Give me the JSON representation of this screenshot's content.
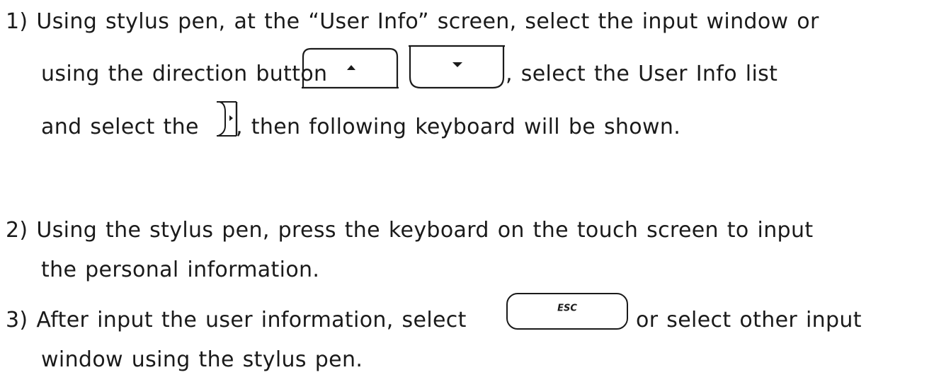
{
  "steps": [
    {
      "number": "1)",
      "lines": [
        "Using stylus pen, at the “User Info” screen, select the input window or",
        "using the direction button",
        ", select the User Info list",
        "and select the",
        ", then following keyboard will be shown."
      ]
    },
    {
      "number": "2)",
      "lines": [
        "Using the stylus pen, press the keyboard on the touch screen to input",
        "the personal information."
      ]
    },
    {
      "number": "3)",
      "lines": [
        "After input the user information, select",
        "or select other input",
        "window using the stylus pen."
      ]
    }
  ],
  "buttons": {
    "esc_label": "ESC"
  },
  "icons": {
    "up": "up-arrow-button-icon",
    "down": "down-arrow-button-icon",
    "right": "right-arrow-tab-icon",
    "esc": "esc-button-icon"
  }
}
